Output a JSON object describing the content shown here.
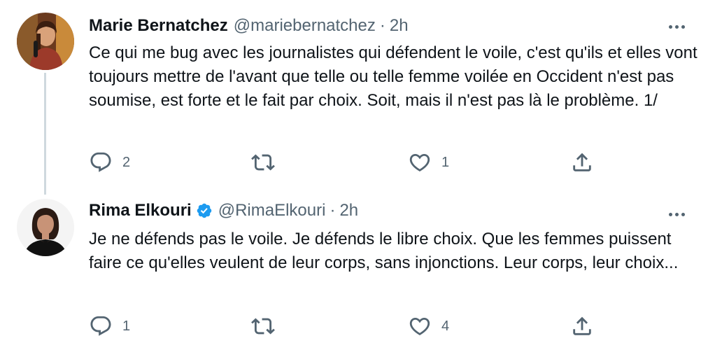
{
  "tweets": [
    {
      "name": "Marie Bernatchez",
      "handle": "@mariebernatchez",
      "separator": "·",
      "time": "2h",
      "text": "Ce qui me bug avec les journalistes qui défendent le voile, c'est qu'ils et elles vont toujours mettre de l'avant que telle ou telle femme voilée en Occident n'est pas soumise, est forte et le fait par choix. Soit, mais il n'est pas là le problème. 1/",
      "verified": false,
      "replies": "2",
      "retweets": "",
      "likes": "1"
    },
    {
      "name": "Rima Elkouri",
      "handle": "@RimaElkouri",
      "separator": "·",
      "time": "2h",
      "text": "Je ne défends pas le voile. Je défends le libre choix. Que les femmes puissent faire ce qu'elles veulent de leur corps, sans injonctions. Leur corps, leur choix...",
      "verified": true,
      "replies": "1",
      "retweets": "",
      "likes": "4"
    }
  ],
  "icons": {
    "reply": "reply-icon",
    "retweet": "retweet-icon",
    "like": "heart-icon",
    "share": "share-icon",
    "more": "more-icon",
    "verified": "verified-badge-icon"
  },
  "colors": {
    "text": "#0f1419",
    "secondary": "#536471",
    "verified": "#1d9bf0",
    "thread_line": "#cfd9de"
  }
}
